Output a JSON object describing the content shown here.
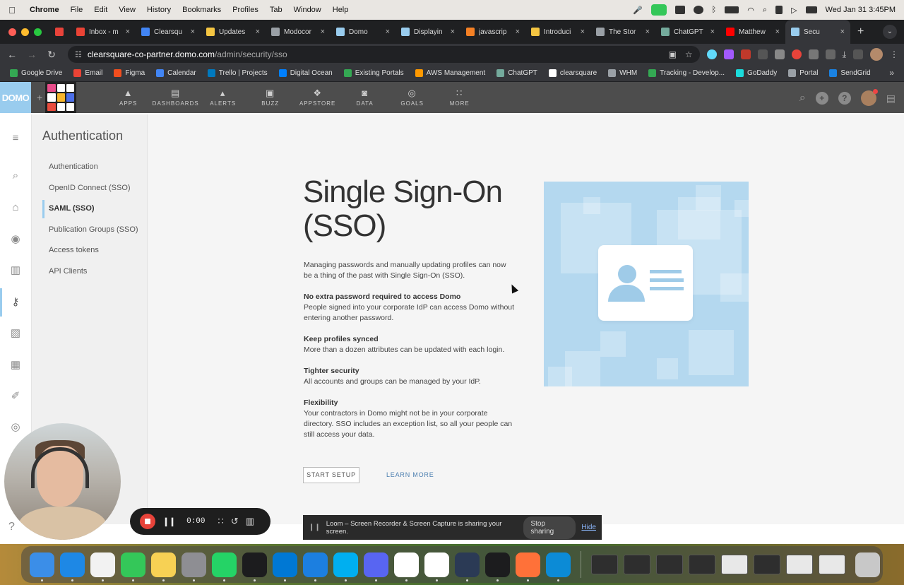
{
  "menubar": {
    "app": "Chrome",
    "items": [
      "File",
      "Edit",
      "View",
      "History",
      "Bookmarks",
      "Profiles",
      "Tab",
      "Window",
      "Help"
    ],
    "datetime": "Wed Jan 31  3:45PM"
  },
  "tabs": [
    {
      "label": "",
      "icon": "loom-icon",
      "color": "#e8433a"
    },
    {
      "label": "Inbox - m",
      "icon": "gmail-icon",
      "color": "#ea4335"
    },
    {
      "label": "Clearsqu",
      "icon": "calendar-icon",
      "color": "#4285f4"
    },
    {
      "label": "Updates",
      "icon": "python-icon",
      "color": "#f4c542"
    },
    {
      "label": "Modocor",
      "icon": "globe-icon",
      "color": "#9aa0a6"
    },
    {
      "label": "Domo",
      "icon": "domo-icon",
      "color": "#99ccee"
    },
    {
      "label": "Displayin",
      "icon": "domo-icon",
      "color": "#99ccee"
    },
    {
      "label": "javascrip",
      "icon": "stackoverflow-icon",
      "color": "#f48024"
    },
    {
      "label": "Introduci",
      "icon": "python-icon",
      "color": "#f4c542"
    },
    {
      "label": "The Stor",
      "icon": "globe-icon",
      "color": "#9aa0a6"
    },
    {
      "label": "ChatGPT",
      "icon": "chatgpt-icon",
      "color": "#74aa9c"
    },
    {
      "label": "Matthew",
      "icon": "youtube-icon",
      "color": "#ff0000"
    },
    {
      "label": "Secu",
      "icon": "domo-icon",
      "color": "#99ccee",
      "active": true
    }
  ],
  "address": {
    "site": "clearsquare-co-partner.domo.com",
    "path": "/admin/security/sso"
  },
  "bookmarks": [
    {
      "label": "Google Drive",
      "color": "#34a853"
    },
    {
      "label": "Email",
      "color": "#ea4335"
    },
    {
      "label": "Figma",
      "color": "#f24e1e"
    },
    {
      "label": "Calendar",
      "color": "#4285f4"
    },
    {
      "label": "Trello | Projects",
      "color": "#0079bf"
    },
    {
      "label": "Digital Ocean",
      "color": "#0080ff"
    },
    {
      "label": "Existing Portals",
      "color": "#34a853"
    },
    {
      "label": "AWS Management",
      "color": "#ff9900"
    },
    {
      "label": "ChatGPT",
      "color": "#74aa9c"
    },
    {
      "label": "clearsquare",
      "color": "#ffffff"
    },
    {
      "label": "WHM",
      "color": "#9aa0a6"
    },
    {
      "label": "Tracking - Develop...",
      "color": "#34a853"
    },
    {
      "label": "GoDaddy",
      "color": "#1bdbdb"
    },
    {
      "label": "Portal",
      "color": "#9aa0a6"
    },
    {
      "label": "SendGrid",
      "color": "#1a82e2"
    }
  ],
  "domo": {
    "logo": "DOMO",
    "nav": [
      {
        "label": "APPS",
        "icon": "rocket-icon"
      },
      {
        "label": "DASHBOARDS",
        "icon": "dashboards-icon"
      },
      {
        "label": "ALERTS",
        "icon": "bell-icon"
      },
      {
        "label": "BUZZ",
        "icon": "chat-icon"
      },
      {
        "label": "APPSTORE",
        "icon": "store-icon"
      },
      {
        "label": "DATA",
        "icon": "database-icon"
      },
      {
        "label": "GOALS",
        "icon": "target-icon"
      },
      {
        "label": "MORE",
        "icon": "grid-icon"
      }
    ],
    "accent": "#99ccee"
  },
  "subnav": {
    "title": "Authentication",
    "items": [
      {
        "label": "Authentication"
      },
      {
        "label": "OpenID Connect (SSO)"
      },
      {
        "label": "SAML (SSO)",
        "active": true
      },
      {
        "label": "Publication Groups (SSO)"
      },
      {
        "label": "Access tokens"
      },
      {
        "label": "API Clients"
      }
    ]
  },
  "content": {
    "title": "Single Sign-On (SSO)",
    "intro": "Managing passwords and manually updating profiles can now be a thing of the past with Single Sign-On (SSO).",
    "features": [
      {
        "heading": "No extra password required to access Domo",
        "text": "People signed into your corporate IdP can access Domo without entering another password."
      },
      {
        "heading": "Keep profiles synced",
        "text": "More than a dozen attributes can be updated with each login."
      },
      {
        "heading": "Tighter security",
        "text": "All accounts and groups can be managed by your IdP."
      },
      {
        "heading": "Flexibility",
        "text": "Your contractors in Domo might not be in your corporate directory. SSO includes an exception list, so all your people can still access your data."
      }
    ],
    "start_setup": "START SETUP",
    "learn_more": "LEARN MORE"
  },
  "loom": {
    "time": "0:00",
    "share_text": "Loom – Screen Recorder & Screen Capture is sharing your screen.",
    "stop_sharing": "Stop sharing",
    "hide": "Hide"
  },
  "dock": [
    {
      "name": "finder",
      "color": "#3b8ee8"
    },
    {
      "name": "safari",
      "color": "#1e88e5"
    },
    {
      "name": "chrome",
      "color": "#f2f2f2"
    },
    {
      "name": "messages",
      "color": "#34c759"
    },
    {
      "name": "notes",
      "color": "#f7d154"
    },
    {
      "name": "system-settings",
      "color": "#8e8e93"
    },
    {
      "name": "whatsapp",
      "color": "#25d366"
    },
    {
      "name": "terminal",
      "color": "#1c1c1e"
    },
    {
      "name": "vscode",
      "color": "#0078d4"
    },
    {
      "name": "xcode",
      "color": "#1c7fe0"
    },
    {
      "name": "skype",
      "color": "#00aff0"
    },
    {
      "name": "discord",
      "color": "#5865f2"
    },
    {
      "name": "slack",
      "color": "#ffffff"
    },
    {
      "name": "mongodb",
      "color": "#ffffff"
    },
    {
      "name": "cloud-app",
      "color": "#2b3a55"
    },
    {
      "name": "activity-monitor",
      "color": "#1c1c1e"
    },
    {
      "name": "firefox",
      "color": "#ff7139"
    },
    {
      "name": "edge",
      "color": "#0c8bd6"
    }
  ]
}
